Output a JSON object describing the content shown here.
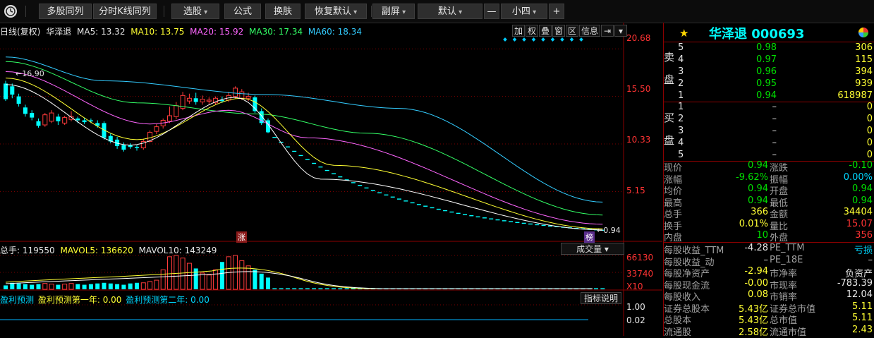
{
  "toolbar": {
    "multi_stock": "多股同列",
    "intraday_kline": "分时K线同列",
    "stock_select": "选股",
    "formula": "公式",
    "skin": "换肤",
    "restore_default": "恢复默认",
    "sub_screen": "副屏",
    "default": "默认",
    "minus": "—",
    "font_size": "小四",
    "plus": "+"
  },
  "chart_header": {
    "period": "日线(复权)",
    "name": "华泽退",
    "ma5": "MA5: 13.32",
    "ma10": "MA10: 13.75",
    "ma20": "MA20: 15.92",
    "ma30": "MA30: 17.34",
    "ma60": "MA60: 18.34"
  },
  "chart_buttons": [
    "加",
    "权",
    "叠",
    "窗",
    "区",
    "信息"
  ],
  "price_labels": [
    "20.68",
    "15.50",
    "10.33",
    "5.15"
  ],
  "high_marker": "16.90",
  "low_marker": "0.94",
  "zhang_tag": "涨",
  "bang_tag": "榜",
  "volume": {
    "header_total": "总手: 119550",
    "header_mavol5": "MAVOL5: 136620",
    "header_mavol10": "MAVOL10: 143249",
    "button": "成交量",
    "axis": [
      "66130",
      "33740",
      "X10"
    ]
  },
  "forecast": {
    "label1": "盈利预测",
    "label2": "盈利预测第一年: 0.00",
    "label3": "盈利预测第二年: 0.00",
    "button": "指标说明",
    "axis": [
      "1.00",
      "0.02"
    ]
  },
  "chart_data": {
    "type": "candlestick",
    "title": "华泽退 000693 日线(复权)",
    "ylim": [
      0.5,
      22
    ],
    "y_ticks": [
      20.68,
      15.5,
      10.33,
      5.15
    ],
    "candles": [
      {
        "o": 15.2,
        "c": 16.9,
        "h": 17.2,
        "l": 15.0,
        "up": false
      },
      {
        "o": 16.6,
        "c": 15.7,
        "h": 16.9,
        "l": 15.3,
        "up": false
      },
      {
        "o": 15.5,
        "c": 14.7,
        "h": 15.8,
        "l": 14.4,
        "up": false
      },
      {
        "o": 14.3,
        "c": 13.6,
        "h": 14.6,
        "l": 13.3,
        "up": false
      },
      {
        "o": 13.7,
        "c": 13.2,
        "h": 14.0,
        "l": 12.9,
        "up": false
      },
      {
        "o": 12.8,
        "c": 12.3,
        "h": 13.1,
        "l": 12.1,
        "up": false
      },
      {
        "o": 12.4,
        "c": 13.5,
        "h": 13.7,
        "l": 12.2,
        "up": true
      },
      {
        "o": 12.8,
        "c": 13.7,
        "h": 14.0,
        "l": 12.6,
        "up": true
      },
      {
        "o": 13.3,
        "c": 12.8,
        "h": 13.6,
        "l": 12.4,
        "up": false
      },
      {
        "o": 12.6,
        "c": 13.2,
        "h": 13.4,
        "l": 12.4,
        "up": true
      },
      {
        "o": 13.0,
        "c": 13.3,
        "h": 13.9,
        "l": 12.8,
        "up": true
      },
      {
        "o": 13.1,
        "c": 12.9,
        "h": 13.3,
        "l": 12.6,
        "up": false
      },
      {
        "o": 12.9,
        "c": 12.7,
        "h": 13.2,
        "l": 12.5,
        "up": false
      },
      {
        "o": 12.8,
        "c": 12.9,
        "h": 13.1,
        "l": 12.6,
        "up": false
      },
      {
        "o": 12.6,
        "c": 12.3,
        "h": 12.9,
        "l": 12.1,
        "up": false
      },
      {
        "o": 12.6,
        "c": 11.0,
        "h": 12.8,
        "l": 10.8,
        "up": false
      },
      {
        "o": 11.2,
        "c": 10.6,
        "h": 11.5,
        "l": 10.4,
        "up": false
      },
      {
        "o": 10.8,
        "c": 10.1,
        "h": 11.1,
        "l": 9.8,
        "up": false
      },
      {
        "o": 10.2,
        "c": 9.7,
        "h": 10.5,
        "l": 9.5,
        "up": false
      },
      {
        "o": 10.2,
        "c": 10.0,
        "h": 10.4,
        "l": 9.8,
        "up": false
      },
      {
        "o": 10.0,
        "c": 9.9,
        "h": 10.2,
        "l": 9.6,
        "up": false
      },
      {
        "o": 9.9,
        "c": 10.6,
        "h": 10.9,
        "l": 9.7,
        "up": true
      },
      {
        "o": 10.6,
        "c": 11.6,
        "h": 11.8,
        "l": 10.5,
        "up": true
      },
      {
        "o": 11.7,
        "c": 12.2,
        "h": 12.5,
        "l": 11.4,
        "up": true
      },
      {
        "o": 12.3,
        "c": 12.9,
        "h": 13.1,
        "l": 12.0,
        "up": true
      },
      {
        "o": 12.8,
        "c": 13.4,
        "h": 14.4,
        "l": 12.6,
        "up": true
      },
      {
        "o": 13.3,
        "c": 14.5,
        "h": 14.9,
        "l": 13.0,
        "up": true
      },
      {
        "o": 14.2,
        "c": 15.6,
        "h": 16.0,
        "l": 14.0,
        "up": true
      },
      {
        "o": 15.0,
        "c": 15.3,
        "h": 15.8,
        "l": 14.7,
        "up": true
      },
      {
        "o": 15.3,
        "c": 14.9,
        "h": 15.9,
        "l": 14.6,
        "up": false
      },
      {
        "o": 14.9,
        "c": 15.2,
        "h": 15.6,
        "l": 14.6,
        "up": true
      },
      {
        "o": 15.1,
        "c": 15.0,
        "h": 15.4,
        "l": 14.7,
        "up": true
      },
      {
        "o": 14.8,
        "c": 15.3,
        "h": 15.5,
        "l": 14.6,
        "up": true
      },
      {
        "o": 15.0,
        "c": 15.1,
        "h": 15.5,
        "l": 14.8,
        "up": false
      },
      {
        "o": 15.1,
        "c": 15.6,
        "h": 16.0,
        "l": 14.9,
        "up": true
      },
      {
        "o": 15.5,
        "c": 16.4,
        "h": 16.6,
        "l": 15.3,
        "up": true
      },
      {
        "o": 16.0,
        "c": 15.3,
        "h": 16.3,
        "l": 15.1,
        "up": true
      },
      {
        "o": 15.3,
        "c": 15.5,
        "h": 15.9,
        "l": 15.0,
        "up": true
      },
      {
        "o": 15.4,
        "c": 13.9,
        "h": 15.6,
        "l": 13.7,
        "up": false
      },
      {
        "o": 13.9,
        "c": 12.6,
        "h": 14.2,
        "l": 12.4,
        "up": false
      },
      {
        "o": 12.9,
        "c": 11.6,
        "h": 13.1,
        "l": 11.5,
        "up": false
      }
    ],
    "limit_down_start": 11.6,
    "limit_down_end": 0.94,
    "ma_colors": {
      "ma5": "#ffffff",
      "ma10": "#ffff33",
      "ma20": "#ff66ff",
      "ma30": "#33ff66",
      "ma60": "#33ccff"
    }
  },
  "panel": {
    "title": "华泽退  000693",
    "sell_label": [
      "卖",
      "盘"
    ],
    "buy_label": [
      "买",
      "盘"
    ],
    "sell": [
      {
        "lvl": "5",
        "price": "0.98",
        "vol": "306"
      },
      {
        "lvl": "4",
        "price": "0.97",
        "vol": "115"
      },
      {
        "lvl": "3",
        "price": "0.96",
        "vol": "394"
      },
      {
        "lvl": "2",
        "price": "0.95",
        "vol": "939"
      },
      {
        "lvl": "1",
        "price": "0.94",
        "vol": "618987"
      }
    ],
    "buy": [
      {
        "lvl": "1",
        "price": "–",
        "vol": "0"
      },
      {
        "lvl": "2",
        "price": "–",
        "vol": "0"
      },
      {
        "lvl": "3",
        "price": "–",
        "vol": "0"
      },
      {
        "lvl": "4",
        "price": "–",
        "vol": "0"
      },
      {
        "lvl": "5",
        "price": "–",
        "vol": "0"
      }
    ],
    "quote": [
      {
        "l": "现价",
        "lv": "0.94",
        "lc": "green",
        "r": "涨跌",
        "rv": "-0.10",
        "rc": "green"
      },
      {
        "l": "涨幅",
        "lv": "-9.62%",
        "lc": "green",
        "r": "振幅",
        "rv": "0.00%",
        "rc": "cyan"
      },
      {
        "l": "均价",
        "lv": "0.94",
        "lc": "green",
        "r": "开盘",
        "rv": "0.94",
        "rc": "green"
      },
      {
        "l": "最高",
        "lv": "0.94",
        "lc": "green",
        "r": "最低",
        "rv": "0.94",
        "rc": "green"
      },
      {
        "l": "总手",
        "lv": "366",
        "lc": "yellow",
        "r": "金额",
        "rv": "34404",
        "rc": "yellow"
      },
      {
        "l": "换手",
        "lv": "0.01%",
        "lc": "yellow",
        "r": "量比",
        "rv": "15.07",
        "rc": "red"
      },
      {
        "l": "内盘",
        "lv": "10",
        "lc": "green",
        "r": "外盘",
        "rv": "356",
        "rc": "red"
      }
    ],
    "fundamentals": [
      {
        "l": "每股收益_TTM",
        "lv": "-4.28",
        "lc": "white",
        "r": "PE_TTM",
        "rv": "亏损",
        "rc": "cyan"
      },
      {
        "l": "每股收益_动",
        "lv": "–",
        "lc": "white",
        "r": "PE_18E",
        "rv": "–",
        "rc": "white"
      },
      {
        "l": "每股净资产",
        "lv": "-2.94",
        "lc": "yellow",
        "r": "市净率",
        "rv": "负资产",
        "rc": "white"
      },
      {
        "l": "每股现金流",
        "lv": "-0.00",
        "lc": "yellow",
        "r": "市现率",
        "rv": "-783.39",
        "rc": "white"
      },
      {
        "l": "每股收入",
        "lv": "0.08",
        "lc": "yellow",
        "r": "市销率",
        "rv": "12.04",
        "rc": "white"
      },
      {
        "l": "证券总股本",
        "lv": "5.43亿",
        "lc": "yellow",
        "r": "证券总市值",
        "rv": "5.11",
        "rc": "yellow"
      },
      {
        "l": "总股本",
        "lv": "5.43亿",
        "lc": "yellow",
        "r": "总市值",
        "rv": "5.11",
        "rc": "yellow"
      },
      {
        "l": "流通股",
        "lv": "2.58亿",
        "lc": "yellow",
        "r": "流通市值",
        "rv": "2.43",
        "rc": "yellow"
      }
    ]
  }
}
